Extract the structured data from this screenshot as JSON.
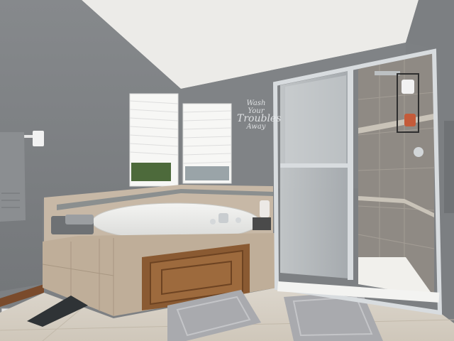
{
  "scene": {
    "description_label": "bathroom",
    "wall_decal": {
      "line1": "Wash",
      "line2": "Your",
      "line3": "Troubles",
      "line4": "Away"
    }
  },
  "colors": {
    "wall": "#7d8083",
    "ceiling": "#ecebe8",
    "tile": "#c7b8a6",
    "tile_dark": "#a89782",
    "floor": "#d9d2c6",
    "wood": "#8a5a32",
    "glass": "#b9bec1",
    "frame": "#d8dcdf",
    "rug": "#a9aaae",
    "towel": "#8b8e91",
    "baseboard": "#7a4b2c"
  }
}
